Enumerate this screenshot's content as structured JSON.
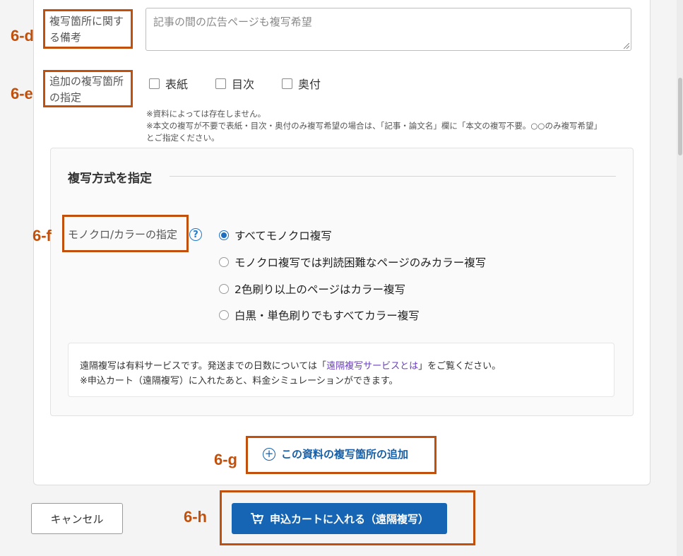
{
  "fields": {
    "remarks_label_line1": "複写箇所に関す",
    "remarks_label_line2": "る備考",
    "remarks_value": "記事の間の広告ページも複写希望",
    "extra_label_line1": "追加の複写箇所",
    "extra_label_line2": "の指定",
    "checkboxes": [
      {
        "label": "表紙",
        "checked": false
      },
      {
        "label": "目次",
        "checked": false
      },
      {
        "label": "奥付",
        "checked": false
      }
    ],
    "notes": [
      "※資料によっては存在しません。",
      "※本文の複写が不要で表紙・目次・奥付のみ複写希望の場合は、「記事・論文名」欄に「本文の複写不要。○○のみ複写希望」",
      "とご指定ください。"
    ]
  },
  "method": {
    "title": "複写方式を指定",
    "color_label": "モノクロ/カラーの指定",
    "help_glyph": "?",
    "options": [
      {
        "label": "すべてモノクロ複写",
        "selected": true
      },
      {
        "label": "モノクロ複写では判読困難なページのみカラー複写",
        "selected": false
      },
      {
        "label": "2色刷り以上のページはカラー複写",
        "selected": false
      },
      {
        "label": "白黒・単色刷りでもすべてカラー複写",
        "selected": false
      }
    ],
    "info_pre": "遠隔複写は有料サービスです。発送までの日数については「",
    "info_link": "遠隔複写サービスとは",
    "info_post": "」をご覧ください。",
    "info_line2": "※申込カート（遠隔複写）に入れたあと、料金シミュレーションができます。"
  },
  "actions": {
    "add_location": "この資料の複写箇所の追加",
    "cancel": "キャンセル",
    "add_to_cart": "申込カートに入れる（遠隔複写）"
  },
  "annotations": {
    "d": "6-d",
    "e": "6-e",
    "f": "6-f",
    "g": "6-g",
    "h": "6-h"
  },
  "colors": {
    "accent": "#1565b4",
    "annotation": "#c0500c",
    "link": "#6a3fbd"
  }
}
